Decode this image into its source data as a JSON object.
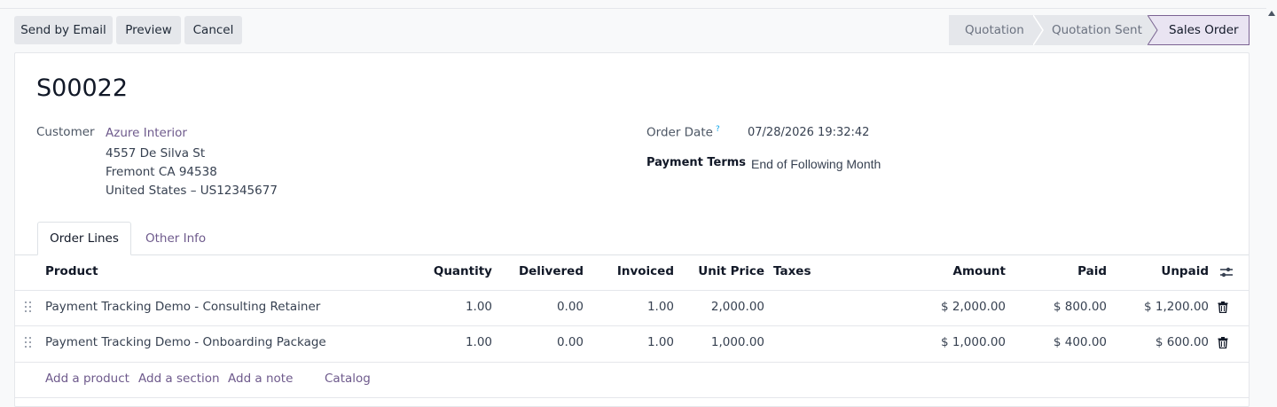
{
  "toolbar": {
    "send_by_email": "Send by Email",
    "preview": "Preview",
    "cancel": "Cancel"
  },
  "statusbar": {
    "stages": [
      "Quotation",
      "Quotation Sent",
      "Sales Order"
    ],
    "active": "Sales Order"
  },
  "order": {
    "name": "S00022",
    "customer_label": "Customer",
    "customer_name": "Azure Interior",
    "address_line1": "4557 De Silva St",
    "address_line2": "Fremont CA 94538",
    "address_line3": "United States – US12345677",
    "order_date_label": "Order Date",
    "order_date_help": "?",
    "order_date": "07/28/2026 19:32:42",
    "payment_terms_label": "Payment Terms",
    "payment_terms": "End of Following Month"
  },
  "tabs": [
    "Order Lines",
    "Other Info"
  ],
  "table": {
    "headers": {
      "product": "Product",
      "quantity": "Quantity",
      "delivered": "Delivered",
      "invoiced": "Invoiced",
      "unit_price": "Unit Price",
      "taxes": "Taxes",
      "amount": "Amount",
      "paid": "Paid",
      "unpaid": "Unpaid"
    },
    "rows": [
      {
        "product": "Payment Tracking Demo - Consulting Retainer",
        "quantity": "1.00",
        "delivered": "0.00",
        "invoiced": "1.00",
        "unit_price": "2,000.00",
        "taxes": "",
        "amount": "$ 2,000.00",
        "paid": "$ 800.00",
        "unpaid": "$ 1,200.00"
      },
      {
        "product": "Payment Tracking Demo - Onboarding Package",
        "quantity": "1.00",
        "delivered": "0.00",
        "invoiced": "1.00",
        "unit_price": "1,000.00",
        "taxes": "",
        "amount": "$ 1,000.00",
        "paid": "$ 400.00",
        "unpaid": "$ 600.00"
      }
    ],
    "add_links": {
      "add_product": "Add a product",
      "add_section": "Add a section",
      "add_note": "Add a note",
      "catalog": "Catalog"
    }
  },
  "colors": {
    "accent": "#6e5a8c",
    "active_stage_bg": "#e9e4f2",
    "button_bg": "#e5e7eb"
  }
}
